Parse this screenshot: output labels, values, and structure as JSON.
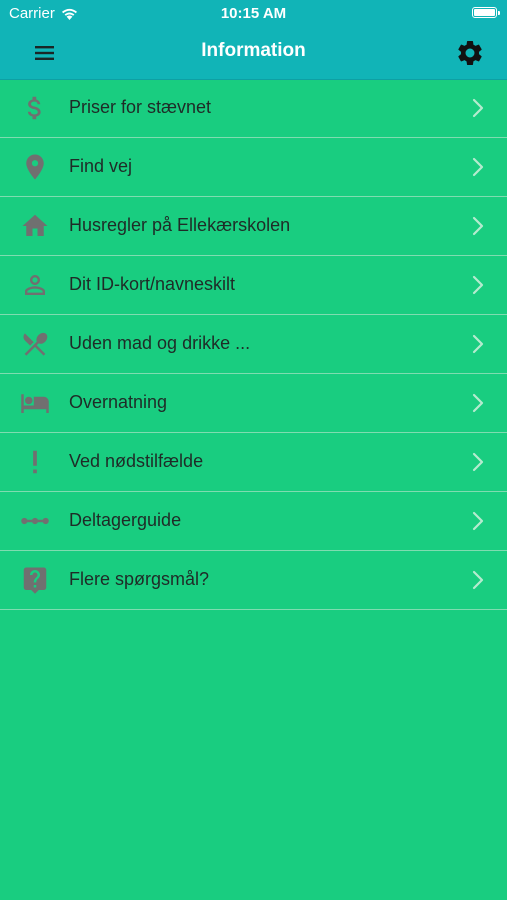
{
  "status_bar": {
    "carrier": "Carrier",
    "time": "10:15 AM"
  },
  "header": {
    "title": "Information",
    "menu_icon": "hamburger-menu-icon",
    "settings_icon": "gear-icon"
  },
  "colors": {
    "header_background": "#11b4b7",
    "list_background": "#19cd80",
    "icon_color": "#707070",
    "text_color": "#1f2b27"
  },
  "list": {
    "items": [
      {
        "label": "Priser for stævnet",
        "icon": "dollar-icon"
      },
      {
        "label": "Find vej",
        "icon": "map-pin-icon"
      },
      {
        "label": "Husregler på Ellekærskolen",
        "icon": "house-icon"
      },
      {
        "label": "Dit ID-kort/navneskilt",
        "icon": "person-icon"
      },
      {
        "label": "Uden mad og drikke ...",
        "icon": "fork-spoon-icon"
      },
      {
        "label": "Overnatning",
        "icon": "bed-icon"
      },
      {
        "label": "Ved nødstilfælde",
        "icon": "exclamation-icon"
      },
      {
        "label": "Deltagerguide",
        "icon": "dots-line-icon"
      },
      {
        "label": "Flere spørgsmål?",
        "icon": "question-bubble-icon"
      }
    ]
  }
}
